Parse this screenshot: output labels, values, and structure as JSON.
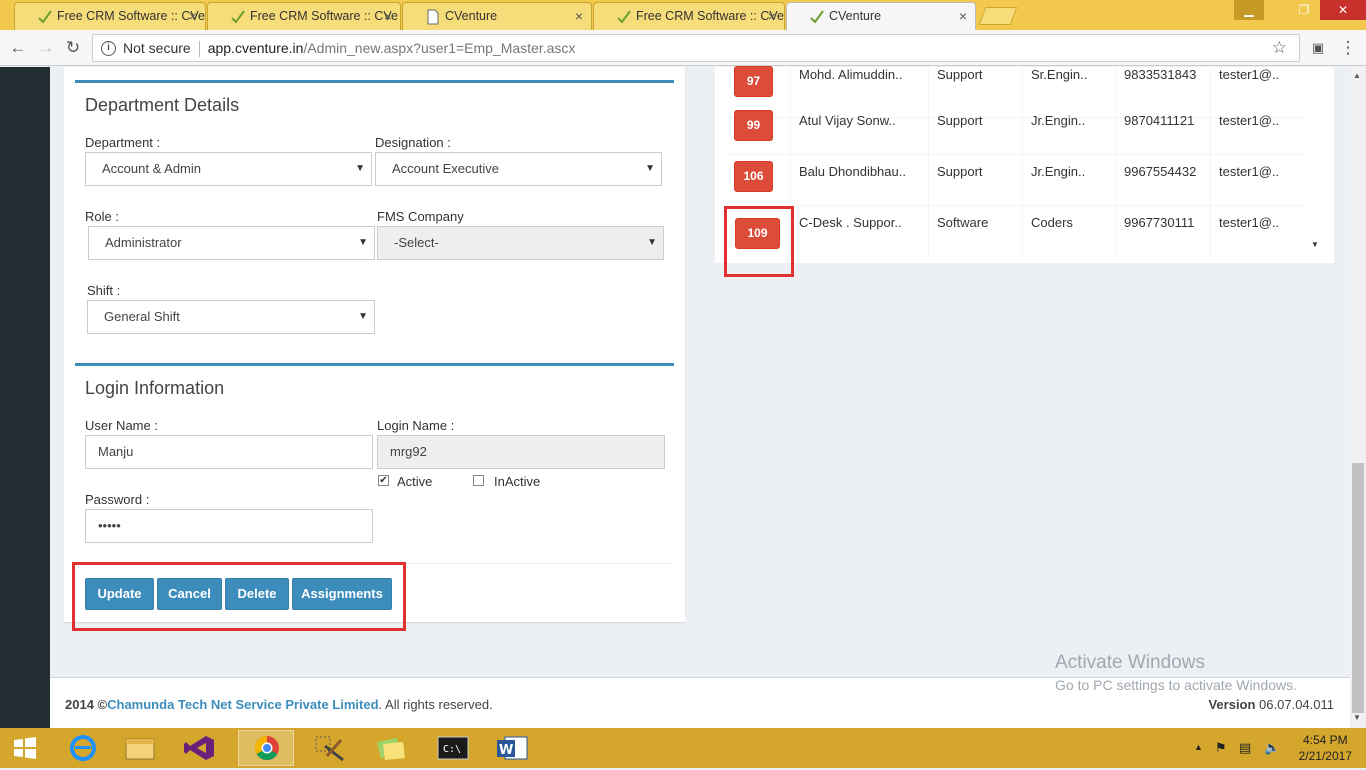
{
  "browser": {
    "tabs": [
      {
        "title": "Free CRM Software :: CVe"
      },
      {
        "title": "Free CRM Software :: CVe"
      },
      {
        "title": "CVenture"
      },
      {
        "title": "Free CRM Software :: CVe"
      },
      {
        "title": "CVenture"
      }
    ],
    "close_glyph": "×",
    "security_label": "Not secure",
    "url_host": "app.cventure.in",
    "url_path": "/Admin_new.aspx?user1=Emp_Master.ascx"
  },
  "department": {
    "title": "Department Details",
    "department_label": "Department :",
    "department_value": "Account & Admin",
    "designation_label": "Designation :",
    "designation_value": "Account Executive",
    "role_label": "Role :",
    "role_value": "Administrator",
    "fms_label": "FMS Company",
    "fms_value": "-Select-",
    "shift_label": "Shift :",
    "shift_value": "General Shift"
  },
  "login": {
    "title": "Login Information",
    "username_label": "User Name :",
    "username_value": "Manju",
    "loginname_label": "Login Name :",
    "loginname_value": "mrg92",
    "active_label": "Active",
    "active_checked": true,
    "inactive_label": "InActive",
    "inactive_checked": false,
    "password_label": "Password :",
    "password_value": "•••••"
  },
  "buttons": {
    "update": "Update",
    "cancel": "Cancel",
    "delete": "Delete",
    "assignments": "Assignments"
  },
  "employees": [
    {
      "id": "97",
      "name": "Mohd. Alimuddin..",
      "dept": "Support",
      "designation": "Sr.Engin..",
      "phone": "9833531843",
      "email": "tester1@.."
    },
    {
      "id": "99",
      "name": "Atul Vijay Sonw..",
      "dept": "Support",
      "designation": "Jr.Engin..",
      "phone": "9870411121",
      "email": "tester1@.."
    },
    {
      "id": "106",
      "name": "Balu Dhondibhau..",
      "dept": "Support",
      "designation": "Jr.Engin..",
      "phone": "9967554432",
      "email": "tester1@.."
    },
    {
      "id": "109",
      "name": "C-Desk . Suppor..",
      "dept": "Software",
      "designation": "Coders",
      "phone": "9967730111",
      "email": "tester1@.."
    }
  ],
  "footer": {
    "year_prefix": "2014 ©",
    "company": "Chamunda Tech Net Service Private Limited",
    "rights": ". All rights reserved.",
    "version_label": "Version",
    "version_value": " 06.07.04.011"
  },
  "watermark": {
    "line1": "Activate Windows",
    "line2": "Go to PC settings to activate Windows."
  },
  "taskbar": {
    "time": "4:54 PM",
    "date": "2/21/2017"
  },
  "colors": {
    "primary": "#3c8dbc",
    "danger": "#dd4b39",
    "highlight": "#e03030",
    "sidebar": "#222d32"
  }
}
